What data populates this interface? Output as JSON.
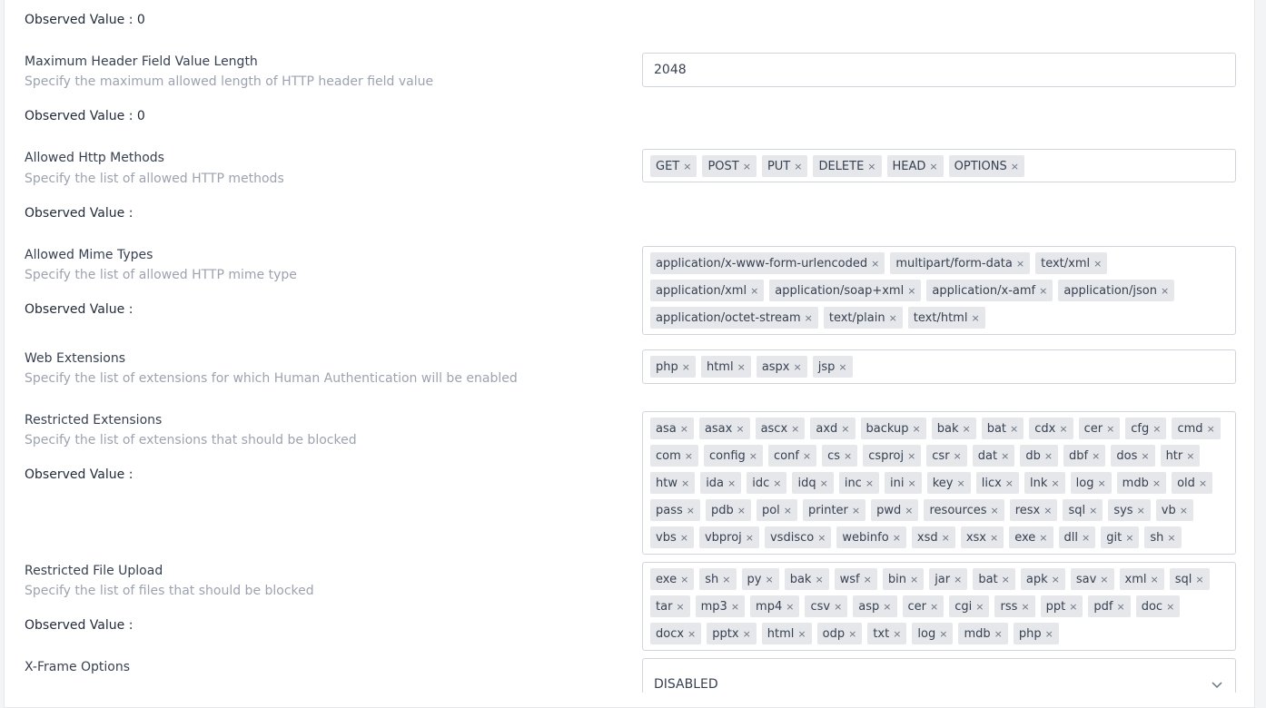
{
  "rows": {
    "top": {
      "observed": "Observed Value : 0"
    },
    "max_header": {
      "label": "Maximum Header Field Value Length",
      "desc": "Specify the maximum allowed length of HTTP header field value",
      "value": "2048",
      "observed": "Observed Value : 0"
    },
    "methods": {
      "label": "Allowed Http Methods",
      "desc": "Specify the list of allowed HTTP methods",
      "observed": "Observed Value :",
      "tags": [
        "GET",
        "POST",
        "PUT",
        "DELETE",
        "HEAD",
        "OPTIONS"
      ]
    },
    "mime": {
      "label": "Allowed Mime Types",
      "desc": "Specify the list of allowed HTTP mime type",
      "observed": "Observed Value :",
      "tags": [
        "application/x-www-form-urlencoded",
        "multipart/form-data",
        "text/xml",
        "application/xml",
        "application/soap+xml",
        "application/x-amf",
        "application/json",
        "application/octet-stream",
        "text/plain",
        "text/html"
      ]
    },
    "web_ext": {
      "label": "Web Extensions",
      "desc": "Specify the list of extensions for which Human Authentication will be enabled",
      "tags": [
        "php",
        "html",
        "aspx",
        "jsp"
      ]
    },
    "restricted_ext": {
      "label": "Restricted Extensions",
      "desc": "Specify the list of extensions that should be blocked",
      "observed": "Observed Value :",
      "tags": [
        "asa",
        "asax",
        "ascx",
        "axd",
        "backup",
        "bak",
        "bat",
        "cdx",
        "cer",
        "cfg",
        "cmd",
        "com",
        "config",
        "conf",
        "cs",
        "csproj",
        "csr",
        "dat",
        "db",
        "dbf",
        "dos",
        "htr",
        "htw",
        "ida",
        "idc",
        "idq",
        "inc",
        "ini",
        "key",
        "licx",
        "lnk",
        "log",
        "mdb",
        "old",
        "pass",
        "pdb",
        "pol",
        "printer",
        "pwd",
        "resources",
        "resx",
        "sql",
        "sys",
        "vb",
        "vbs",
        "vbproj",
        "vsdisco",
        "webinfo",
        "xsd",
        "xsx",
        "exe",
        "dll",
        "git",
        "sh"
      ]
    },
    "restricted_upload": {
      "label": "Restricted File Upload",
      "desc": "Specify the list of files that should be blocked",
      "observed": "Observed Value :",
      "tags": [
        "exe",
        "sh",
        "py",
        "bak",
        "wsf",
        "bin",
        "jar",
        "bat",
        "apk",
        "sav",
        "xml",
        "sql",
        "tar",
        "mp3",
        "mp4",
        "csv",
        "asp",
        "cer",
        "cgi",
        "rss",
        "ppt",
        "pdf",
        "doc",
        "docx",
        "pptx",
        "html",
        "odp",
        "txt",
        "log",
        "mdb",
        "php"
      ]
    },
    "xframe": {
      "label": "X-Frame Options",
      "value": "DISABLED"
    }
  },
  "remove_glyph": "×",
  "icons": {
    "remove": "close-icon",
    "select": "chevron-down-icon"
  }
}
